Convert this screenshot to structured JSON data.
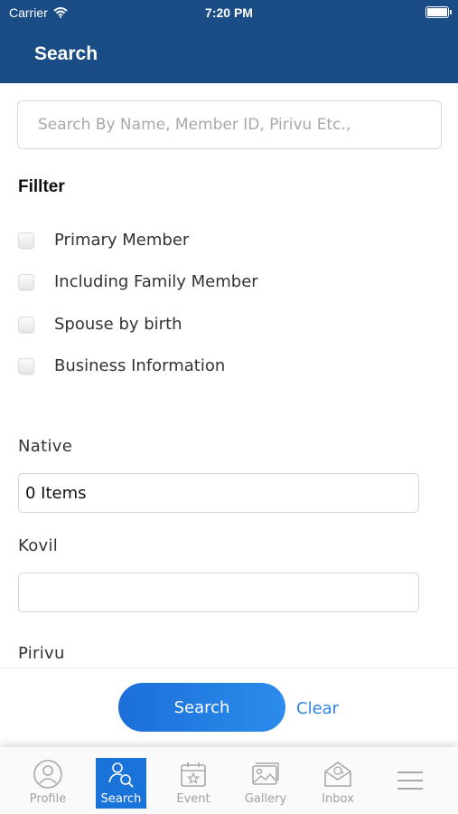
{
  "status_bar": {
    "carrier": "Carrier",
    "time": "7:20 PM"
  },
  "header": {
    "title": "Search"
  },
  "search": {
    "placeholder": "Search By Name, Member ID, Pirivu Etc.,"
  },
  "filter": {
    "title": "Fillter",
    "options": [
      {
        "label": "Primary Member",
        "checked": false
      },
      {
        "label": "Including Family Member",
        "checked": false
      },
      {
        "label": "Spouse by birth",
        "checked": false
      },
      {
        "label": "Business Information",
        "checked": false
      }
    ]
  },
  "fields": {
    "native": {
      "label": "Native",
      "value": "0 Items"
    },
    "kovil": {
      "label": "Kovil",
      "value": ""
    },
    "pirivu": {
      "label": "Pirivu"
    }
  },
  "actions": {
    "search_label": "Search",
    "clear_label": "Clear"
  },
  "tabbar": {
    "active": "Search",
    "items": [
      {
        "label": "Profile",
        "icon": "profile-icon"
      },
      {
        "label": "Search",
        "icon": "search-user-icon"
      },
      {
        "label": "Event",
        "icon": "calendar-star-icon"
      },
      {
        "label": "Gallery",
        "icon": "gallery-icon"
      },
      {
        "label": "Inbox",
        "icon": "mail-icon"
      },
      {
        "label": "",
        "icon": "menu-icon"
      }
    ]
  },
  "colors": {
    "header": "#1a4c86",
    "accent": "#1a73d9",
    "link": "#2d86e3"
  }
}
